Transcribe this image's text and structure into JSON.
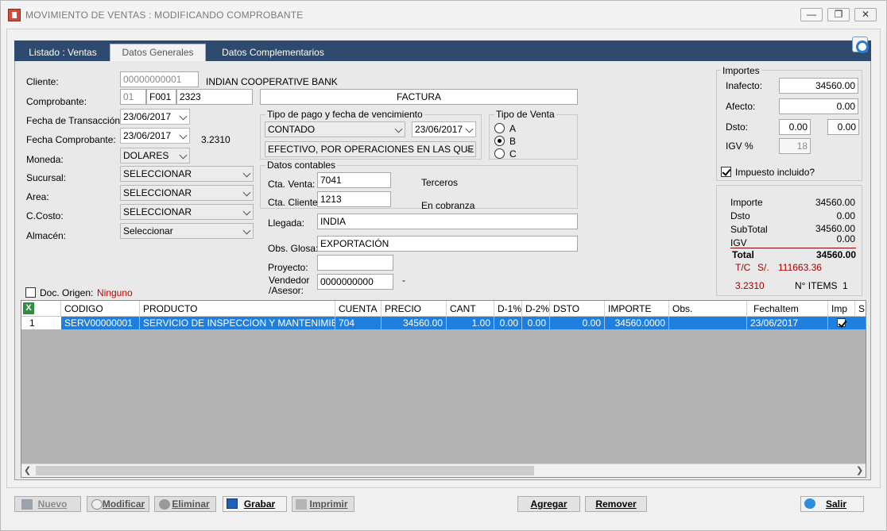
{
  "window": {
    "title": "MOVIMIENTO DE VENTAS : MODIFICANDO COMPROBANTE"
  },
  "tabs": [
    {
      "label": "Listado : Ventas",
      "active": false
    },
    {
      "label": "Datos Generales",
      "active": true
    },
    {
      "label": "Datos Complementarios",
      "active": false
    }
  ],
  "form": {
    "cliente_label": "Cliente:",
    "cliente_code": "00000000001",
    "cliente_name": "INDIAN COOPERATIVE BANK",
    "comprobante_label": "Comprobante:",
    "comprobante_tipo": "01",
    "comprobante_serie": "F001",
    "comprobante_numero": "2323",
    "comprobante_desc": "FACTURA",
    "fecha_trans_label": "Fecha de Transacción:",
    "fecha_trans": "23/06/2017",
    "fecha_comp_label": "Fecha Comprobante:",
    "fecha_comp": "23/06/2017",
    "tipo_cambio": "3.2310",
    "moneda_label": "Moneda:",
    "moneda": "DOLARES",
    "sucursal_label": "Sucursal:",
    "sucursal": "SELECCIONAR",
    "area_label": "Area:",
    "area": "SELECCIONAR",
    "ccosto_label": "C.Costo:",
    "ccosto": "SELECCIONAR",
    "almacen_label": "Almacén:",
    "almacen": "Seleccionar",
    "doc_origen_label": "Doc. Origen:",
    "doc_origen_value": "Ninguno"
  },
  "pago": {
    "group_title": "Tipo de pago y fecha de vencimiento",
    "tipo": "CONTADO",
    "fecha_venc": "23/06/2017",
    "medio": "EFECTIVO, POR OPERACIONES EN LAS QUE NO"
  },
  "tipo_venta": {
    "group_title": "Tipo de Venta",
    "options": [
      "A",
      "B",
      "C"
    ],
    "selected": "B"
  },
  "contables": {
    "group_title": "Datos contables",
    "cta_venta_label": "Cta. Venta:",
    "cta_venta": "7041",
    "cta_venta_note": "Terceros",
    "cta_cliente_label": "Cta. Cliente:",
    "cta_cliente": "1213",
    "cta_cliente_note": "En cobranza"
  },
  "extras": {
    "llegada_label": "Llegada:",
    "llegada": "INDIA",
    "obs_label": "Obs. Glosa:",
    "obs": "EXPORTACIÓN",
    "proyecto_label": "Proyecto:",
    "proyecto": "",
    "vendedor_label1": "Vendedor",
    "vendedor_label2": "/Asesor:",
    "vendedor": "0000000000",
    "vendedor_suffix": "-"
  },
  "importes": {
    "group_title": "Importes",
    "inafecto_label": "Inafecto:",
    "inafecto": "34560.00",
    "afecto_label": "Afecto:",
    "afecto": "0.00",
    "dsto_label": "Dsto:",
    "dsto1": "0.00",
    "dsto2": "0.00",
    "igv_label": "IGV %",
    "igv": "18",
    "impuesto_label": "Impuesto incluido?",
    "impuesto_checked": true
  },
  "summary": {
    "importe_label": "Importe",
    "importe": "34560.00",
    "dsto_label": "Dsto",
    "dsto": "0.00",
    "subtotal_label": "SubTotal",
    "subtotal": "34560.00",
    "igv_label": "IGV",
    "igv": "0.00",
    "total_label": "Total",
    "total": "34560.00",
    "tc_label": "T/C",
    "soles_label": "S/.",
    "soles": "111663.36",
    "tipo_cambio": "3.2310",
    "items_label": "N° ITEMS",
    "items": "1"
  },
  "grid": {
    "columns": [
      "CODIGO",
      "PRODUCTO",
      "CUENTA",
      "PRECIO",
      "CANT",
      "D-1%",
      "D-2%",
      "DSTO",
      "IMPORTE",
      "Obs.",
      "FechaItem",
      "Imp",
      "S"
    ],
    "rows": [
      {
        "num": "1",
        "codigo": "SERV00000001",
        "producto": "SERVICIO DE INSPECCION Y MANTENIMIEN...",
        "cuenta": "704",
        "precio": "34560.00",
        "cant": "1.00",
        "d1": "0.00",
        "d2": "0.00",
        "dsto": "0.00",
        "importe": "34560.0000",
        "obs": "",
        "fecha": "23/06/2017",
        "imp": true
      }
    ]
  },
  "buttons": {
    "nuevo": "Nuevo",
    "modificar": "Modificar",
    "eliminar": "Eliminar",
    "grabar": "Grabar",
    "imprimir": "Imprimir",
    "agregar": "Agregar",
    "remover": "Remover",
    "salir": "Salir"
  },
  "colors": {
    "selection": "#1f7fde",
    "tabstrip": "#2e4a6e",
    "alert": "#c00000",
    "accent_red": "#a00000"
  }
}
